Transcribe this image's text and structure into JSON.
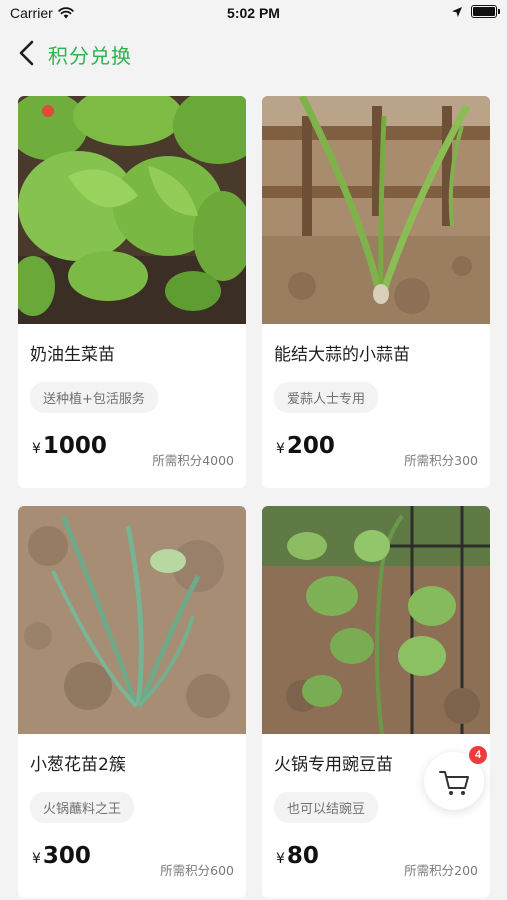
{
  "status_bar": {
    "carrier": "Carrier",
    "time": "5:02 PM",
    "battery_level": 0.95
  },
  "nav": {
    "title": "积分兑换"
  },
  "products": [
    {
      "name": "奶油生菜苗",
      "tag": "送种植+包活服务",
      "currency": "¥",
      "price": "1000",
      "points": "所需积分4000"
    },
    {
      "name": "能结大蒜的小蒜苗",
      "tag": "爱蒜人士专用",
      "currency": "¥",
      "price": "200",
      "points": "所需积分300"
    },
    {
      "name": "小葱花苗2簇",
      "tag": "火锅蘸料之王",
      "currency": "¥",
      "price": "300",
      "points": "所需积分600"
    },
    {
      "name": "火锅专用豌豆苗",
      "tag": "也可以结豌豆",
      "currency": "¥",
      "price": "80",
      "points": "所需积分200"
    }
  ],
  "cart": {
    "badge_count": "4",
    "icon": "cart-icon"
  },
  "colors": {
    "accent": "#2fb34f",
    "badge": "#ef3b3b"
  }
}
